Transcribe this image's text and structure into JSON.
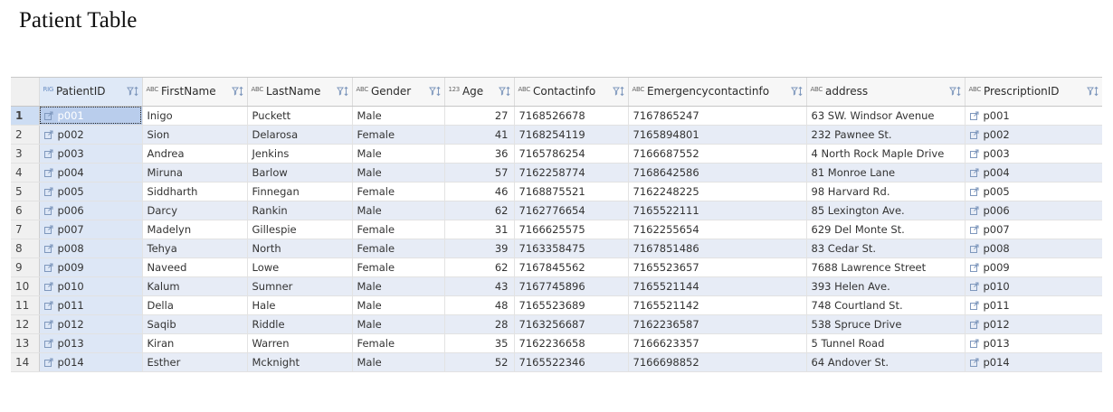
{
  "page_title": "Patient Table",
  "grid": {
    "columns": [
      {
        "badge": "RIG",
        "label": "PatientID"
      },
      {
        "badge": "ABC",
        "label": "FirstName"
      },
      {
        "badge": "ABC",
        "label": "LastName"
      },
      {
        "badge": "ABC",
        "label": "Gender"
      },
      {
        "badge": "123",
        "label": "Age"
      },
      {
        "badge": "ABC",
        "label": "Contactinfo"
      },
      {
        "badge": "ABC",
        "label": "Emergencycontactinfo"
      },
      {
        "badge": "ABC",
        "label": "address"
      },
      {
        "badge": "ABC",
        "label": "PrescriptionID"
      }
    ],
    "rows": [
      {
        "n": "1",
        "id": "p001",
        "first": "Inigo",
        "last": "Puckett",
        "gender": "Male",
        "age": "27",
        "contact": "7168526678",
        "emergency": "7167865247",
        "address": "63 SW. Windsor Avenue",
        "rx": "p001"
      },
      {
        "n": "2",
        "id": "p002",
        "first": "Sion",
        "last": "Delarosa",
        "gender": "Female",
        "age": "41",
        "contact": "7168254119",
        "emergency": "7165894801",
        "address": "232 Pawnee St.",
        "rx": "p002"
      },
      {
        "n": "3",
        "id": "p003",
        "first": "Andrea",
        "last": "Jenkins",
        "gender": "Male",
        "age": "36",
        "contact": "7165786254",
        "emergency": "7166687552",
        "address": "4 North Rock Maple Drive",
        "rx": "p003"
      },
      {
        "n": "4",
        "id": "p004",
        "first": "Miruna",
        "last": "Barlow",
        "gender": "Male",
        "age": "57",
        "contact": "7162258774",
        "emergency": "7168642586",
        "address": "81 Monroe Lane",
        "rx": "p004"
      },
      {
        "n": "5",
        "id": "p005",
        "first": "Siddharth",
        "last": "Finnegan",
        "gender": "Female",
        "age": "46",
        "contact": "7168875521",
        "emergency": "7162248225",
        "address": "98 Harvard Rd.",
        "rx": "p005"
      },
      {
        "n": "6",
        "id": "p006",
        "first": "Darcy",
        "last": "Rankin",
        "gender": "Male",
        "age": "62",
        "contact": "7162776654",
        "emergency": "7165522111",
        "address": "85 Lexington Ave.",
        "rx": "p006"
      },
      {
        "n": "7",
        "id": "p007",
        "first": "Madelyn",
        "last": "Gillespie",
        "gender": "Female",
        "age": "31",
        "contact": "7166625575",
        "emergency": "7162255654",
        "address": "629 Del Monte St.",
        "rx": "p007"
      },
      {
        "n": "8",
        "id": "p008",
        "first": "Tehya",
        "last": "North",
        "gender": "Female",
        "age": "39",
        "contact": "7163358475",
        "emergency": "7167851486",
        "address": "83 Cedar St.",
        "rx": "p008"
      },
      {
        "n": "9",
        "id": "p009",
        "first": "Naveed",
        "last": "Lowe",
        "gender": "Female",
        "age": "62",
        "contact": "7167845562",
        "emergency": "7165523657",
        "address": "7688 Lawrence Street",
        "rx": "p009"
      },
      {
        "n": "10",
        "id": "p010",
        "first": "Kalum",
        "last": "Sumner",
        "gender": "Male",
        "age": "43",
        "contact": "7167745896",
        "emergency": "7165521144",
        "address": "393 Helen Ave.",
        "rx": "p010"
      },
      {
        "n": "11",
        "id": "p011",
        "first": "Della",
        "last": "Hale",
        "gender": "Male",
        "age": "48",
        "contact": "7165523689",
        "emergency": "7165521142",
        "address": "748 Courtland St.",
        "rx": "p011"
      },
      {
        "n": "12",
        "id": "p012",
        "first": "Saqib",
        "last": "Riddle",
        "gender": "Male",
        "age": "28",
        "contact": "7163256687",
        "emergency": "7162236587",
        "address": "538 Spruce Drive",
        "rx": "p012"
      },
      {
        "n": "13",
        "id": "p013",
        "first": "Kiran",
        "last": "Warren",
        "gender": "Female",
        "age": "35",
        "contact": "7162236658",
        "emergency": "7166623357",
        "address": "5 Tunnel Road",
        "rx": "p013"
      },
      {
        "n": "14",
        "id": "p014",
        "first": "Esther",
        "last": "Mcknight",
        "gender": "Male",
        "age": "52",
        "contact": "7165522346",
        "emergency": "7166698852",
        "address": "64 Andover St.",
        "rx": "p014"
      }
    ]
  },
  "icons": {
    "column_filter_sort": "filter-sort-icon",
    "foreign_key_link": "link-arrow-icon"
  },
  "colors": {
    "header_bg": "#f7f7f7",
    "row_alt_bg": "#e7ecf6",
    "selected_cell_bg": "#b9cdec",
    "icon_accent": "#7f98bd"
  }
}
